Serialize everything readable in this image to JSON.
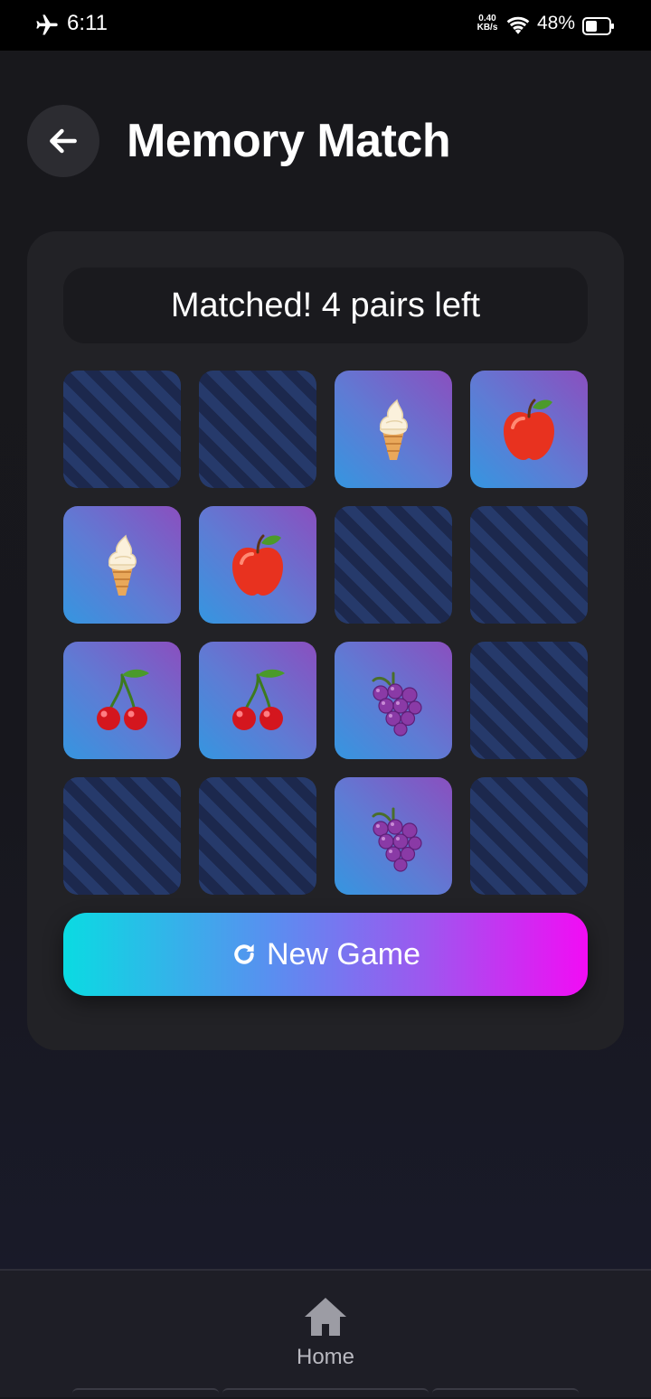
{
  "status_bar": {
    "time": "6:11",
    "net_speed_value": "0.40",
    "net_speed_unit": "KB/s",
    "battery_percent": "48%",
    "icons": [
      "airplane-icon",
      "wifi-icon",
      "battery-icon"
    ]
  },
  "header": {
    "title": "Memory Match",
    "back_icon": "arrow-left-icon"
  },
  "game": {
    "status": "Matched! 4 pairs left",
    "grid": {
      "rows": 4,
      "cols": 4,
      "tiles": [
        {
          "state": "hidden",
          "symbol": ""
        },
        {
          "state": "hidden",
          "symbol": ""
        },
        {
          "state": "revealed",
          "symbol": "ice-cream"
        },
        {
          "state": "revealed",
          "symbol": "apple"
        },
        {
          "state": "revealed",
          "symbol": "ice-cream"
        },
        {
          "state": "revealed",
          "symbol": "apple"
        },
        {
          "state": "hidden",
          "symbol": ""
        },
        {
          "state": "hidden",
          "symbol": ""
        },
        {
          "state": "revealed",
          "symbol": "cherries"
        },
        {
          "state": "revealed",
          "symbol": "cherries"
        },
        {
          "state": "revealed",
          "symbol": "grapes"
        },
        {
          "state": "hidden",
          "symbol": ""
        },
        {
          "state": "hidden",
          "symbol": ""
        },
        {
          "state": "hidden",
          "symbol": ""
        },
        {
          "state": "revealed",
          "symbol": "grapes"
        },
        {
          "state": "hidden",
          "symbol": ""
        }
      ]
    },
    "new_game_label": "New Game",
    "new_game_icon": "refresh-icon"
  },
  "bottom_nav": {
    "items": [
      {
        "label": "Home",
        "icon": "home-icon",
        "active": true
      }
    ]
  },
  "colors": {
    "background": "#17171d",
    "card": "#222226",
    "tile_back": "#1e2b52",
    "tile_face_start": "#8a4fbf",
    "tile_face_end": "#3596e0",
    "button_start": "#0adbe2",
    "button_end": "#f20cf4"
  }
}
